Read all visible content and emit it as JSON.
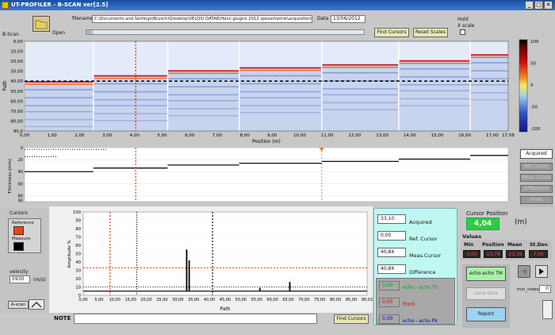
{
  "window": {
    "title": "UT-PROFILER - B-SCAN ver[2.5]",
    "min": "_",
    "max": "□",
    "close": "✕"
  },
  "toolbar": {
    "open_label": "Open",
    "filename_label": "filename",
    "filename_value": "C:\\Documents and Settings\\Bruschi\\Desktop\\VELOSI QATAR\\Halul giugno 2012 spessimetrie\\acquisition\\",
    "data_label": "Data",
    "data_value": "13/06/2012",
    "find_cursors": "Find Cursors",
    "reset_scales": "Reset Scales",
    "hold_label": "Hold",
    "xscale_label": "X scale"
  },
  "bscan": {
    "section_label": "B-Scan",
    "y_label": "Path",
    "x_label": "Position (m)",
    "x_ticks": [
      "0,00",
      "1,00",
      "2,00",
      "3,00",
      "4,00",
      "5,00",
      "6,00",
      "7,00",
      "8,00",
      "9,00",
      "10,00",
      "11,00",
      "12,00",
      "13,00",
      "14,00",
      "15,00",
      "16,00",
      "17,00",
      "17,58"
    ],
    "y_ticks": [
      "0,00",
      "10,00",
      "20,00",
      "30,00",
      "40,00",
      "50,00",
      "60,00",
      "70,00",
      "80,00",
      "90,0"
    ],
    "colorbar_ticks": [
      "100",
      "50",
      "0",
      "-50",
      "-100"
    ],
    "x_range": [
      0,
      17.58
    ],
    "y_range": [
      0,
      90
    ],
    "cursor_position": 4.04,
    "threshold_path": 40,
    "segments": [
      {
        "x0": 0.0,
        "x1": 2.5,
        "front": 40
      },
      {
        "x0": 2.5,
        "x1": 5.2,
        "front": 34
      },
      {
        "x0": 5.2,
        "x1": 7.8,
        "front": 29
      },
      {
        "x0": 7.8,
        "x1": 10.8,
        "front": 26
      },
      {
        "x0": 10.8,
        "x1": 13.6,
        "front": 23
      },
      {
        "x0": 13.6,
        "x1": 16.2,
        "front": 19
      },
      {
        "x0": 16.2,
        "x1": 17.58,
        "front": 13
      }
    ]
  },
  "thickness": {
    "y_label": "Thickness (mm)",
    "y_ticks": [
      "0",
      "20",
      "40",
      "60",
      "80",
      "90"
    ],
    "y_range": [
      0,
      90
    ],
    "cursor_position": 10.8
  },
  "side_buttons": [
    "Acquired",
    "Ref.Cursor",
    "Meas.Cursor",
    "Difference",
    "Front"
  ],
  "cursors": {
    "title": "Cursors",
    "reference_label": "Reference",
    "measure_label": "Measure",
    "velocity_label": "velocity",
    "velocity_value": "5930",
    "velocity_unit": "(m/s)",
    "ascan_label": "A-scan"
  },
  "ascan": {
    "y_label": "Amplitude %",
    "x_label": "Path",
    "x_ticks": [
      "0,00",
      "5,00",
      "10,00",
      "15,00",
      "20,00",
      "25,00",
      "30,00",
      "35,00",
      "40,00",
      "45,00",
      "50,00",
      "55,00",
      "60,00",
      "65,00",
      "70,00",
      "75,00",
      "80,00",
      "85,00",
      "90,02"
    ],
    "y_ticks": [
      "100",
      "90",
      "80",
      "70",
      "60",
      "50",
      "40",
      "30",
      "20",
      "10",
      "0"
    ],
    "x_range": [
      0,
      90.02
    ],
    "y_range": [
      0,
      100
    ],
    "ref_cursor": 8.5,
    "meas_cursor_1": 17.0,
    "meas_cursor_2": 41.0,
    "threshold_amp": 33,
    "floor_amp": 10,
    "peaks": [
      {
        "x": 32.8,
        "y": 55
      },
      {
        "x": 33.6,
        "y": 42
      },
      {
        "x": 56.0,
        "y": 9
      },
      {
        "x": 65.5,
        "y": 16
      }
    ]
  },
  "values_panel": {
    "acquired_value": "33,10",
    "acquired_label": "Acquired",
    "ref_value": "0,00",
    "ref_label": "Ref. Cursor",
    "meas_value": "40,84",
    "meas_label": "Meas.Cursor",
    "diff_value": "40,84",
    "diff_label": "Difference",
    "echo_th_value": "0,00",
    "echo_th_label": "echo - echo Th",
    "front_value": "0,00",
    "front_label": "Front",
    "echo_pk_value": "0,00",
    "echo_pk_label": "echo - echo Pk"
  },
  "position": {
    "title": "Cursor Position",
    "value": "4,04",
    "unit": "(m)"
  },
  "stats": {
    "title": "Values",
    "headers": [
      "Min",
      "Position",
      "Mean",
      "St.Dev."
    ],
    "values": [
      "0,00",
      "10,78",
      "23,36",
      "7,96"
    ]
  },
  "actions": {
    "echo_echo": "echo-echo TM",
    "save_data": "save data",
    "report": "Report",
    "min_index_label": "min_index",
    "min_index_value": "0"
  },
  "bottom": {
    "note_label": "NOTE",
    "find_cursors": "Find Cursors"
  },
  "colors": {
    "cursor_red": "#e8400a",
    "front_red": "#d01010",
    "bscan_bg": "#c8d4ee",
    "lcd_green": "#3ac83a",
    "panel_cyan": "#bff8f2"
  }
}
